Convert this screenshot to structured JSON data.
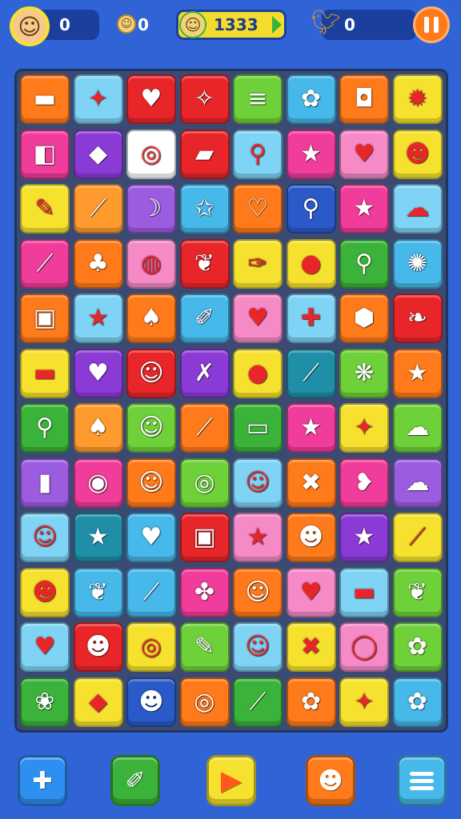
{
  "hud": {
    "player_score": "0",
    "coins_count": "0",
    "main_score": "1333",
    "bird_count": "0"
  },
  "icons": {
    "player_avatar": "boy-face-icon",
    "coin": "coin-icon",
    "score_avatar": "smiley-face-icon",
    "bird": "bird-icon",
    "pause": "pause-icon"
  },
  "board": {
    "rows": [
      [
        {
          "icon": "box-icon",
          "glyph": "▬",
          "color": "#ff7a1a"
        },
        {
          "icon": "star-blob-icon",
          "glyph": "✦",
          "color": "#7fd3f5"
        },
        {
          "icon": "heart-blob-icon",
          "glyph": "♥",
          "color": "#e8262a"
        },
        {
          "icon": "banana-icon",
          "glyph": "✧",
          "color": "#e8262a"
        },
        {
          "icon": "cake-icon",
          "glyph": "≡",
          "color": "#6fd13a"
        },
        {
          "icon": "flower-icon",
          "glyph": "✿",
          "color": "#46b8ea"
        },
        {
          "icon": "safe-icon",
          "glyph": "◘",
          "color": "#ff7a1a"
        },
        {
          "icon": "berry-icon",
          "glyph": "✹",
          "color": "#f6e22e"
        }
      ],
      [
        {
          "icon": "box-icon",
          "glyph": "◧",
          "color": "#f03c9a"
        },
        {
          "icon": "gem-icon",
          "glyph": "◆",
          "color": "#8a3bd6"
        },
        {
          "icon": "orange-slice-icon",
          "glyph": "◎",
          "color": "#ffffff"
        },
        {
          "icon": "cake-slice-icon",
          "glyph": "▰",
          "color": "#e8262a"
        },
        {
          "icon": "lollipop-icon",
          "glyph": "⚲",
          "color": "#7fd3f5"
        },
        {
          "icon": "star-icon",
          "glyph": "★",
          "color": "#f03c9a"
        },
        {
          "icon": "heart-icon",
          "glyph": "♥",
          "color": "#f58ac7"
        },
        {
          "icon": "creature-icon",
          "glyph": "☻",
          "color": "#f6e22e"
        }
      ],
      [
        {
          "icon": "pencil-icon",
          "glyph": "✎",
          "color": "#f6e22e"
        },
        {
          "icon": "carrot-icon",
          "glyph": "⟋",
          "color": "#ff9a2e"
        },
        {
          "icon": "banana-icon",
          "glyph": "☽",
          "color": "#9b5ce0"
        },
        {
          "icon": "star-icon",
          "glyph": "✩",
          "color": "#46b8ea"
        },
        {
          "icon": "heart-icon",
          "glyph": "♡",
          "color": "#ff7a1a"
        },
        {
          "icon": "lollipop-icon",
          "glyph": "⚲",
          "color": "#2a59c8"
        },
        {
          "icon": "smiling-star-icon",
          "glyph": "★",
          "color": "#f03c9a"
        },
        {
          "icon": "cloud-icon",
          "glyph": "☁",
          "color": "#7fd3f5"
        }
      ],
      [
        {
          "icon": "carrot-icon",
          "glyph": "⟋",
          "color": "#f03c9a"
        },
        {
          "icon": "radish-icon",
          "glyph": "♣",
          "color": "#ff7a1a"
        },
        {
          "icon": "lemon-icon",
          "glyph": "◍",
          "color": "#f58ac7"
        },
        {
          "icon": "leaf-icon",
          "glyph": "❦",
          "color": "#e8262a"
        },
        {
          "icon": "feather-icon",
          "glyph": "✑",
          "color": "#f6e22e"
        },
        {
          "icon": "orange-icon",
          "glyph": "●",
          "color": "#f6e22e"
        },
        {
          "icon": "lollipop-icon",
          "glyph": "⚲",
          "color": "#3bb33a"
        },
        {
          "icon": "sun-icon",
          "glyph": "✺",
          "color": "#46b8ea"
        }
      ],
      [
        {
          "icon": "box-icon",
          "glyph": "▣",
          "color": "#ff7a1a"
        },
        {
          "icon": "star-icon",
          "glyph": "★",
          "color": "#7fd3f5"
        },
        {
          "icon": "carrot-icon",
          "glyph": "♠",
          "color": "#ff7a1a"
        },
        {
          "icon": "pencil-icon",
          "glyph": "✐",
          "color": "#46b8ea"
        },
        {
          "icon": "heart-pin-icon",
          "glyph": "♥",
          "color": "#f58ac7"
        },
        {
          "icon": "puzzle-icon",
          "glyph": "✚",
          "color": "#7fd3f5"
        },
        {
          "icon": "acorn-icon",
          "glyph": "⬢",
          "color": "#ff7a1a"
        },
        {
          "icon": "leaf-icon",
          "glyph": "❧",
          "color": "#e8262a"
        }
      ],
      [
        {
          "icon": "box-icon",
          "glyph": "▬",
          "color": "#f6e22e"
        },
        {
          "icon": "heart-icon",
          "glyph": "♥",
          "color": "#8a3bd6"
        },
        {
          "icon": "creature-icon",
          "glyph": "☺",
          "color": "#e8262a"
        },
        {
          "icon": "ribbon-icon",
          "glyph": "✗",
          "color": "#8a3bd6"
        },
        {
          "icon": "apple-icon",
          "glyph": "●",
          "color": "#f6e22e"
        },
        {
          "icon": "popsicle-icon",
          "glyph": "⟋",
          "color": "#1f8fa8"
        },
        {
          "icon": "bubble-icon",
          "glyph": "❋",
          "color": "#6fd13a"
        },
        {
          "icon": "star-icon",
          "glyph": "★",
          "color": "#ff7a1a"
        }
      ],
      [
        {
          "icon": "lollipop-icon",
          "glyph": "⚲",
          "color": "#3bb33a"
        },
        {
          "icon": "radish-icon",
          "glyph": "♠",
          "color": "#ff9a2e"
        },
        {
          "icon": "apple-face-icon",
          "glyph": "☺",
          "color": "#6fd13a"
        },
        {
          "icon": "pencil-icon",
          "glyph": "⟋",
          "color": "#ff7a1a"
        },
        {
          "icon": "suitcase-icon",
          "glyph": "▭",
          "color": "#3bb33a"
        },
        {
          "icon": "star-icon",
          "glyph": "★",
          "color": "#f03c9a"
        },
        {
          "icon": "blob-icon",
          "glyph": "✦",
          "color": "#f6e22e"
        },
        {
          "icon": "cloud-icon",
          "glyph": "☁",
          "color": "#6fd13a"
        }
      ],
      [
        {
          "icon": "book-icon",
          "glyph": "▮",
          "color": "#9b5ce0"
        },
        {
          "icon": "ring-icon",
          "glyph": "◉",
          "color": "#f03c9a"
        },
        {
          "icon": "smiley-icon",
          "glyph": "☺",
          "color": "#ff7a1a"
        },
        {
          "icon": "spiral-icon",
          "glyph": "◎",
          "color": "#6fd13a"
        },
        {
          "icon": "face-icon",
          "glyph": "☺",
          "color": "#7fd3f5"
        },
        {
          "icon": "cross-icon",
          "glyph": "✖",
          "color": "#ff7a1a"
        },
        {
          "icon": "duck-icon",
          "glyph": "❥",
          "color": "#f03c9a"
        },
        {
          "icon": "cloud-icon",
          "glyph": "☁",
          "color": "#9b5ce0"
        }
      ],
      [
        {
          "icon": "face-icon",
          "glyph": "☺",
          "color": "#7fd3f5"
        },
        {
          "icon": "star-icon",
          "glyph": "★",
          "color": "#1f8fa8"
        },
        {
          "icon": "heart-icon",
          "glyph": "♥",
          "color": "#46b8ea"
        },
        {
          "icon": "bag-icon",
          "glyph": "▣",
          "color": "#e8262a"
        },
        {
          "icon": "star-icon",
          "glyph": "★",
          "color": "#f58ac7"
        },
        {
          "icon": "smiley-icon",
          "glyph": "☻",
          "color": "#ff7a1a"
        },
        {
          "icon": "star-icon",
          "glyph": "★",
          "color": "#8a3bd6"
        },
        {
          "icon": "carrot-icon",
          "glyph": "⟋",
          "color": "#f6e22e"
        }
      ],
      [
        {
          "icon": "bird-icon",
          "glyph": "☻",
          "color": "#f6e22e"
        },
        {
          "icon": "leaf-icon",
          "glyph": "❦",
          "color": "#46b8ea"
        },
        {
          "icon": "ice-cream-icon",
          "glyph": "⟋",
          "color": "#46b8ea"
        },
        {
          "icon": "ghost-icon",
          "glyph": "✤",
          "color": "#f03c9a"
        },
        {
          "icon": "apple-face-icon",
          "glyph": "☺",
          "color": "#ff7a1a"
        },
        {
          "icon": "heart-face-icon",
          "glyph": "♥",
          "color": "#f58ac7"
        },
        {
          "icon": "box-icon",
          "glyph": "▬",
          "color": "#7fd3f5"
        },
        {
          "icon": "grape-icon",
          "glyph": "❦",
          "color": "#6fd13a"
        }
      ],
      [
        {
          "icon": "heart-icon",
          "glyph": "♥",
          "color": "#7fd3f5"
        },
        {
          "icon": "smiley-icon",
          "glyph": "☻",
          "color": "#e8262a"
        },
        {
          "icon": "spiral-icon",
          "glyph": "◎",
          "color": "#f6e22e"
        },
        {
          "icon": "pencil-icon",
          "glyph": "✎",
          "color": "#6fd13a"
        },
        {
          "icon": "face-icon",
          "glyph": "☺",
          "color": "#7fd3f5"
        },
        {
          "icon": "candy-icon",
          "glyph": "✖",
          "color": "#f6e22e"
        },
        {
          "icon": "mirror-icon",
          "glyph": "◯",
          "color": "#f58ac7"
        },
        {
          "icon": "bug-icon",
          "glyph": "✿",
          "color": "#6fd13a"
        }
      ],
      [
        {
          "icon": "turtle-icon",
          "glyph": "❀",
          "color": "#3bb33a"
        },
        {
          "icon": "diamond-icon",
          "glyph": "◆",
          "color": "#f6e22e"
        },
        {
          "icon": "monster-icon",
          "glyph": "☻",
          "color": "#2a59c8"
        },
        {
          "icon": "compass-icon",
          "glyph": "◎",
          "color": "#ff7a1a"
        },
        {
          "icon": "pencil-icon",
          "glyph": "⟋",
          "color": "#3bb33a"
        },
        {
          "icon": "shell-icon",
          "glyph": "✿",
          "color": "#ff7a1a"
        },
        {
          "icon": "sparkle-icon",
          "glyph": "✦",
          "color": "#f6e22e"
        },
        {
          "icon": "creature-icon",
          "glyph": "✿",
          "color": "#46b8ea"
        }
      ]
    ]
  },
  "bottom_bar": [
    {
      "name": "puzzle-button",
      "icon": "puzzle-icon",
      "glyph": "✚",
      "color": "#2f8ff0"
    },
    {
      "name": "paint-button",
      "icon": "paint-tube-icon",
      "glyph": "✐",
      "color": "#3bb33a"
    },
    {
      "name": "play-button",
      "icon": "play-icon",
      "glyph": "▶",
      "color": "#f6e22e"
    },
    {
      "name": "shop-button",
      "icon": "robot-icon",
      "glyph": "☻",
      "color": "#ff7a1a"
    },
    {
      "name": "menu-button",
      "icon": "menu-icon",
      "glyph": "",
      "color": "#46b8ea"
    }
  ]
}
